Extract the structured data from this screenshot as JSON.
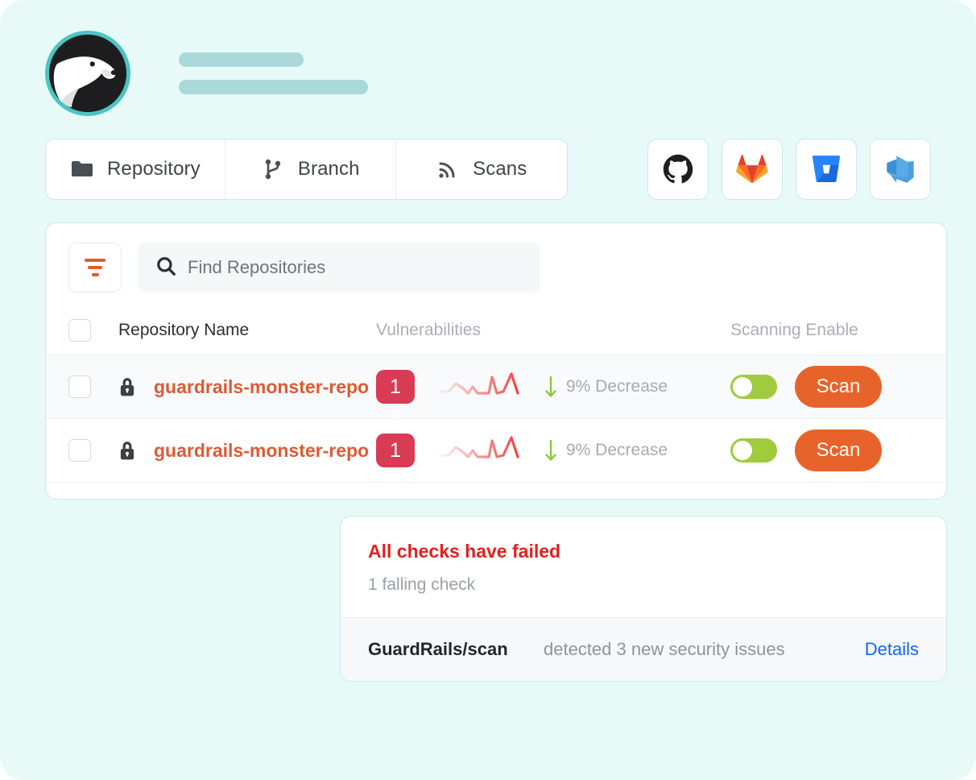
{
  "theme": {
    "background": "#e7faf8",
    "accent_orange": "#e8632a",
    "accent_red": "#d93b54",
    "accent_green": "#9fcb3c",
    "accent_teal": "#4ec3c3",
    "link_blue": "#0a66ff",
    "fail_red": "#e02020"
  },
  "profile": {
    "avatar_icon": "polar-bear-avatar",
    "skeleton_line_1": "",
    "skeleton_line_2": ""
  },
  "tabs": [
    {
      "label": "Repository",
      "icon": "folder-icon"
    },
    {
      "label": "Branch",
      "icon": "git-branch-icon"
    },
    {
      "label": "Scans",
      "icon": "rss-broadcast-icon"
    }
  ],
  "providers": [
    {
      "name": "github",
      "icon": "github-icon"
    },
    {
      "name": "gitlab",
      "icon": "gitlab-icon"
    },
    {
      "name": "bitbucket",
      "icon": "bitbucket-icon"
    },
    {
      "name": "azure-devops",
      "icon": "azure-devops-icon"
    }
  ],
  "toolbar": {
    "filter_icon": "filter-funnel-icon",
    "search_icon": "search-icon",
    "search_placeholder": "Find Repositories",
    "search_value": ""
  },
  "table": {
    "headers": {
      "name": "Repository Name",
      "vulnerabilities": "Vulnerabilities",
      "scanning": "Scanning Enable"
    },
    "rows": [
      {
        "lock_icon": "lock-icon",
        "name": "guardrails-monster-repo",
        "badge": "1",
        "badge_ghost": "2",
        "sparkline_icon": "sparkline-chart",
        "trend_arrow": "arrow-down-icon",
        "trend_text": "9% Decrease",
        "scanning_enabled": true,
        "scan_button": "Scan"
      },
      {
        "lock_icon": "lock-icon",
        "name": "guardrails-monster-repo",
        "badge": "1",
        "badge_ghost": "",
        "sparkline_icon": "sparkline-chart",
        "trend_arrow": "arrow-down-icon",
        "trend_text": "9% Decrease",
        "scanning_enabled": true,
        "scan_button": "Scan"
      }
    ]
  },
  "checks": {
    "title": "All checks have failed",
    "subtitle": "1 falling check",
    "item_name": "GuardRails/scan",
    "item_description": "detected 3 new security issues",
    "details_link": "Details"
  }
}
